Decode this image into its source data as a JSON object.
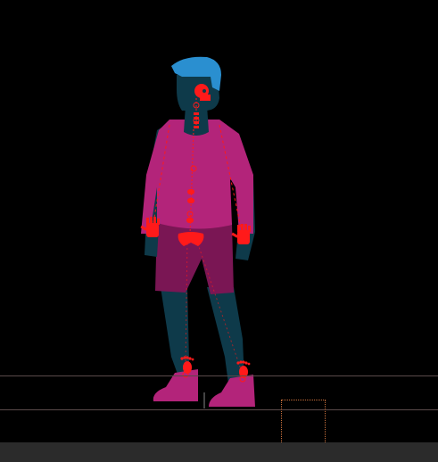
{
  "scene": {
    "background_color": "#000000",
    "ground_line_color": "#5a4a4a",
    "selection_box_color": "#c8703c",
    "bottom_bar_color": "#2b2b2b"
  },
  "character": {
    "hair_color": "#2a8fd0",
    "skin_color": "#0e3a4a",
    "shirt_color": "#b3247a",
    "shorts_color": "#7a1654",
    "shoe_color": "#b3247a",
    "rig_color": "#ff1a1a"
  },
  "rig_icons": {
    "head": "skull-icon",
    "hands": "hand-icon",
    "pelvis": "pelvis-icon",
    "feet": "foot-icon"
  }
}
